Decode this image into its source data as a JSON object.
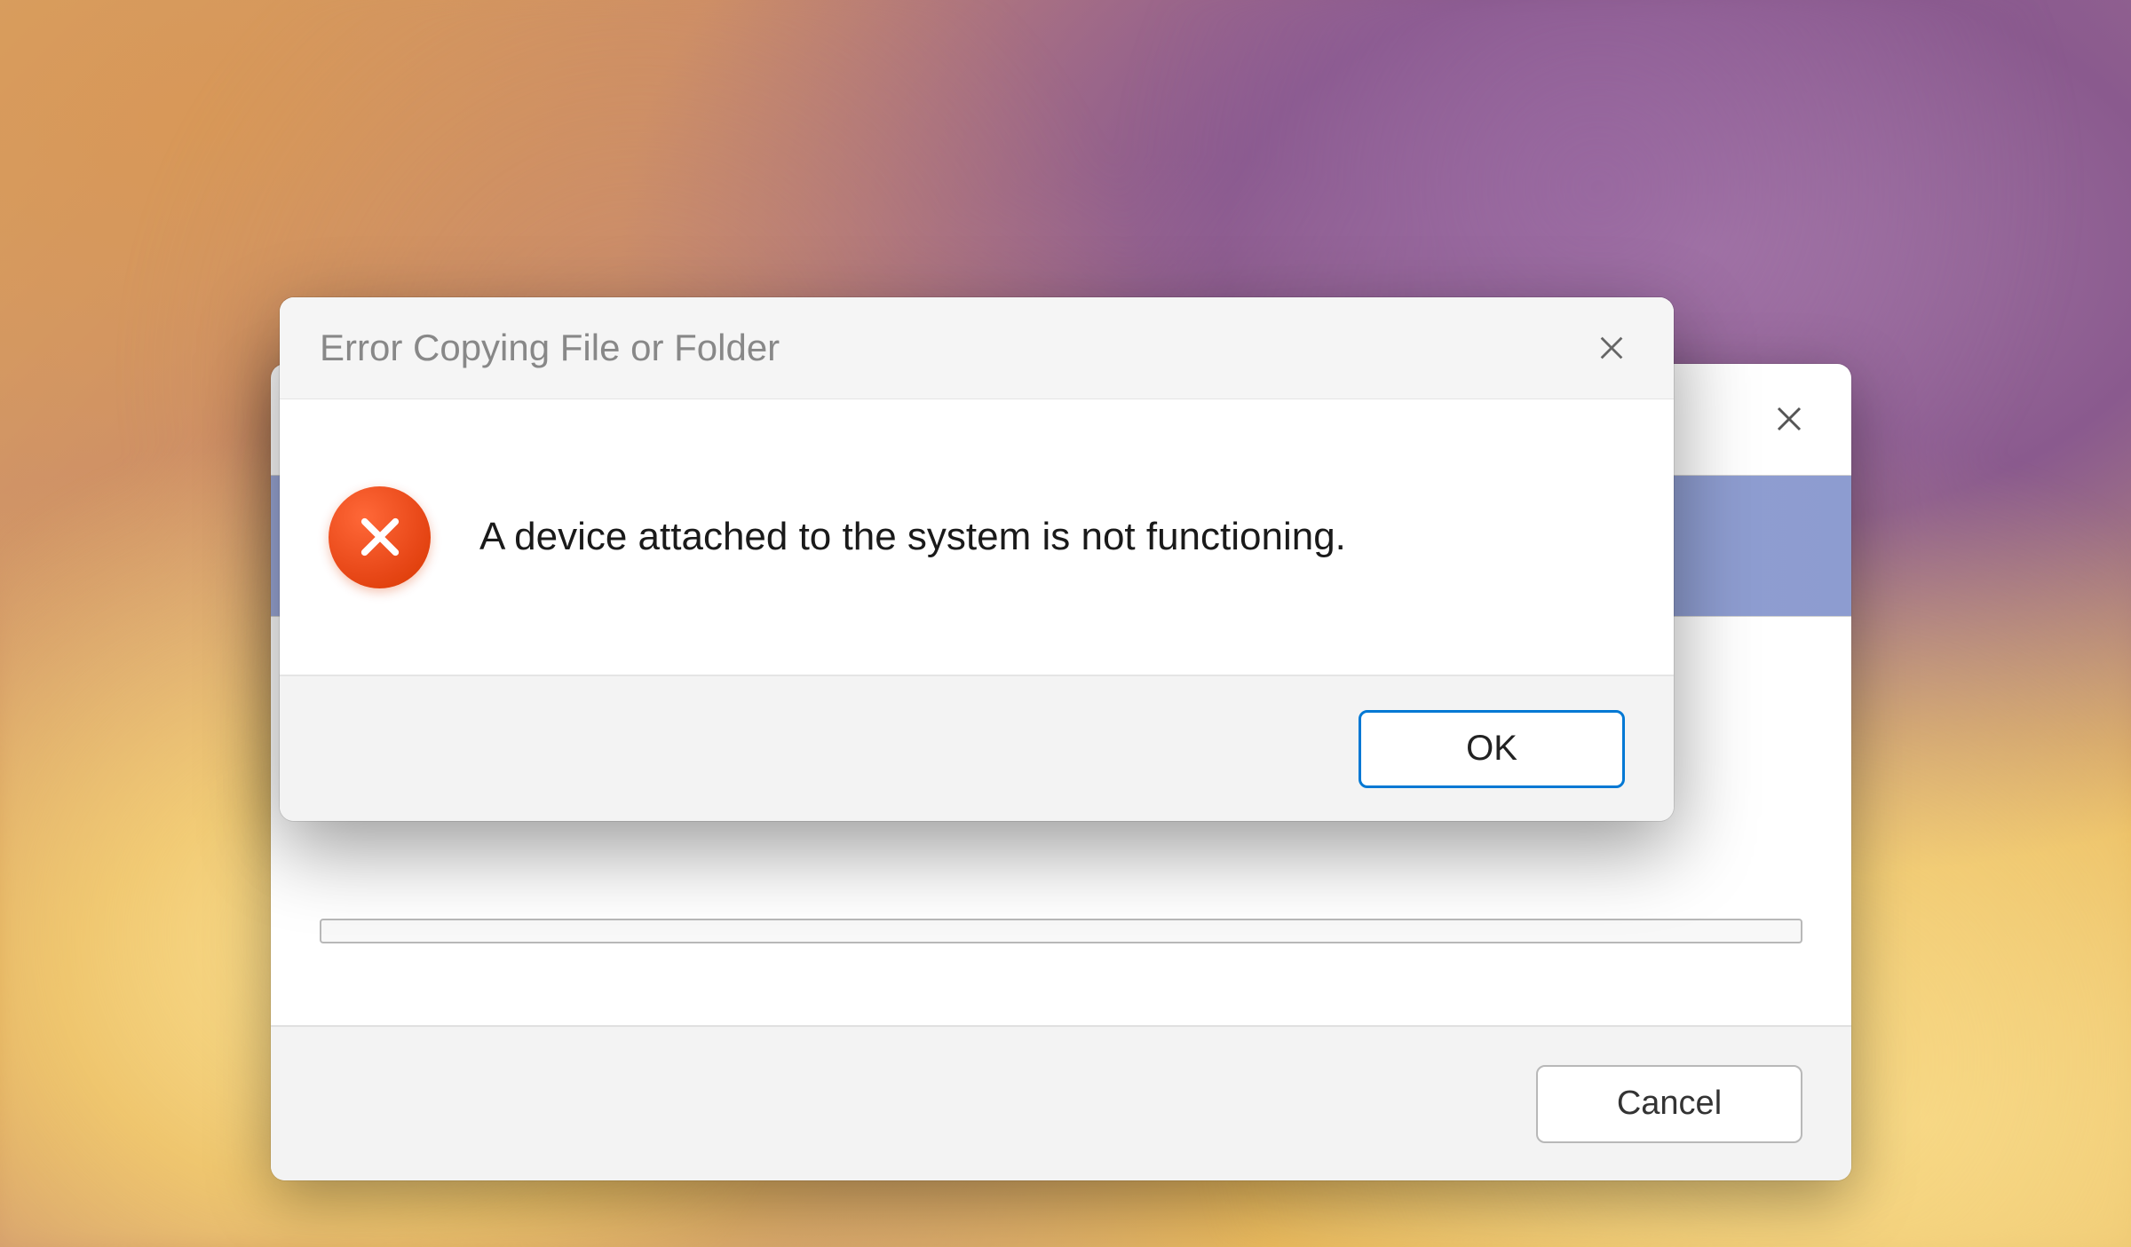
{
  "error_dialog": {
    "title": "Error Copying File or Folder",
    "message": "A device attached to the system is not functioning.",
    "ok_label": "OK"
  },
  "background_dialog": {
    "cancel_label": "Cancel"
  }
}
